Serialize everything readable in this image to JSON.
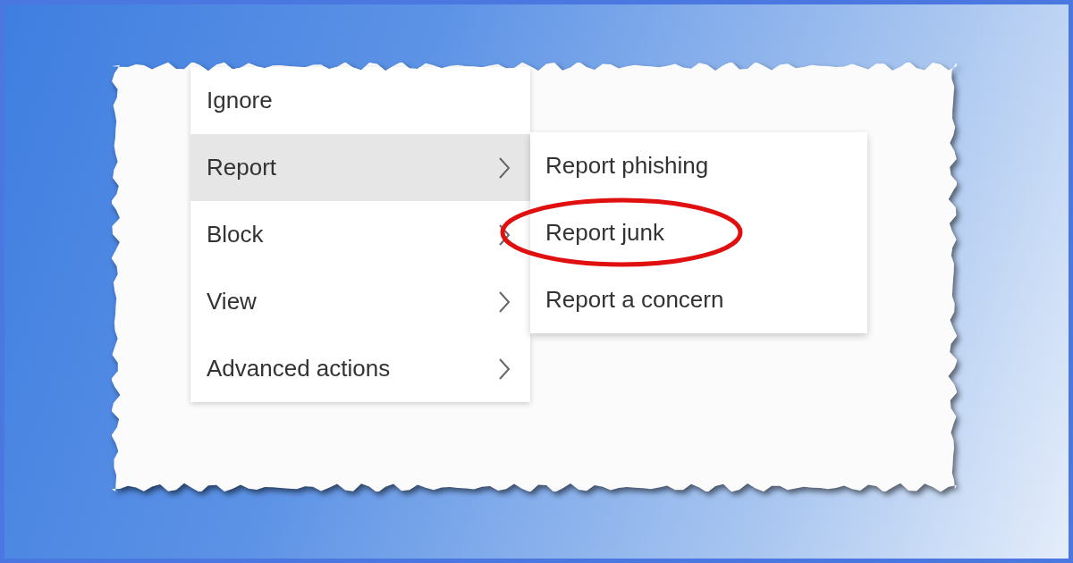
{
  "menu": {
    "items": [
      {
        "label": "Ignore",
        "selected": false,
        "has_submenu": false
      },
      {
        "label": "Report",
        "selected": true,
        "has_submenu": true
      },
      {
        "label": "Block",
        "selected": false,
        "has_submenu": true
      },
      {
        "label": "View",
        "selected": false,
        "has_submenu": true
      },
      {
        "label": "Advanced actions",
        "selected": false,
        "has_submenu": true
      }
    ]
  },
  "submenu": {
    "items": [
      {
        "label": "Report phishing",
        "circled": false
      },
      {
        "label": "Report junk",
        "circled": true
      },
      {
        "label": "Report a concern",
        "circled": false
      }
    ]
  }
}
